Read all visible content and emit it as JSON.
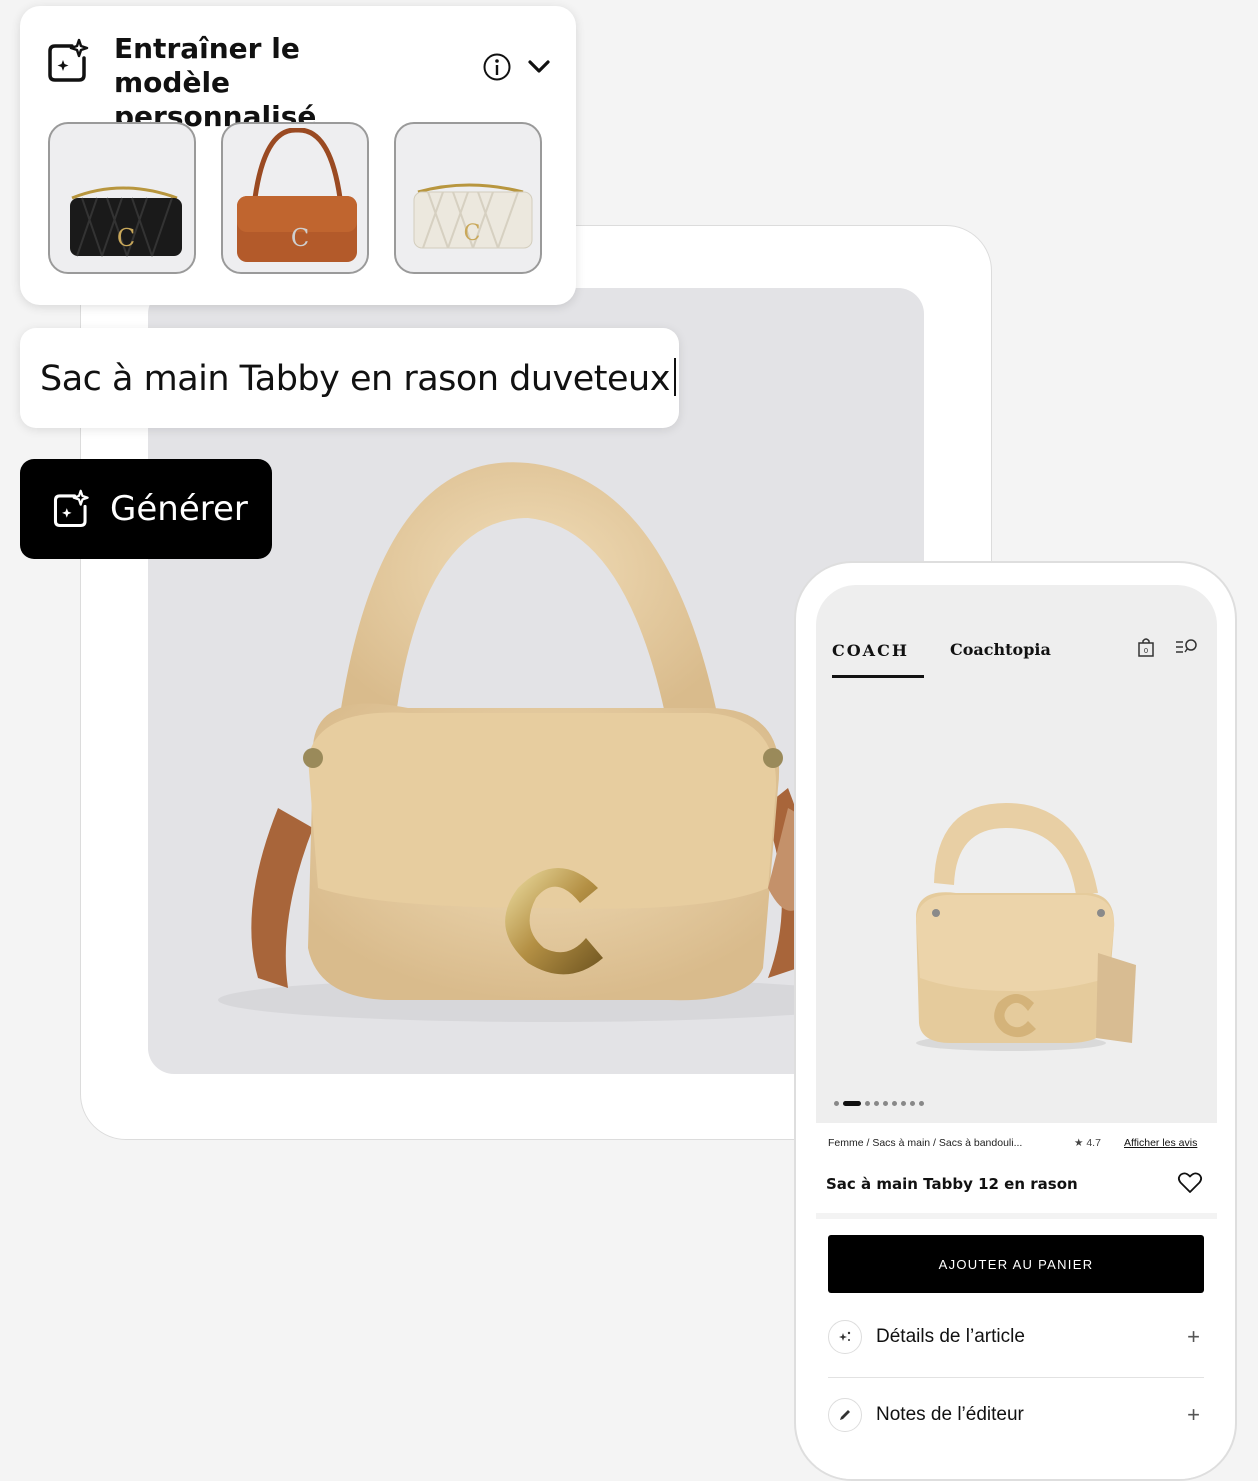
{
  "train_panel": {
    "title": "Entraîner le modèle personnalisé",
    "icons": [
      "sparkle-frame-icon",
      "info-icon",
      "chevron-down-icon"
    ],
    "reference_images": [
      {
        "name": "black-quilted-bag",
        "color": "#1a1a1a"
      },
      {
        "name": "brown-leather-bag",
        "color": "#b35a2a"
      },
      {
        "name": "cream-quilted-bag",
        "color": "#ece8de"
      }
    ]
  },
  "prompt": {
    "value": "Sac à main Tabby en rason duveteux"
  },
  "generate_button": {
    "label": "Générer"
  },
  "phone": {
    "brand": "COACH",
    "subbrand": "Coachtopia",
    "breadcrumb": "Femme / Sacs à main / Sacs à bandouli...",
    "rating": "★ 4.7",
    "reviews_link": "Afficher les avis",
    "product_name": "Sac à main Tabby 12 en rason",
    "cart_button": "AJOUTER AU PANIER",
    "sections": [
      {
        "label": "Détails de l’article",
        "icon": "sparkle-icon"
      },
      {
        "label": "Notes de l’éditeur",
        "icon": "pencil-icon"
      }
    ]
  },
  "colors": {
    "fur": "#e8cfa4",
    "strap_leather": "#a8653a",
    "gold": "#c9a85a",
    "background": "#f4f4f4"
  }
}
